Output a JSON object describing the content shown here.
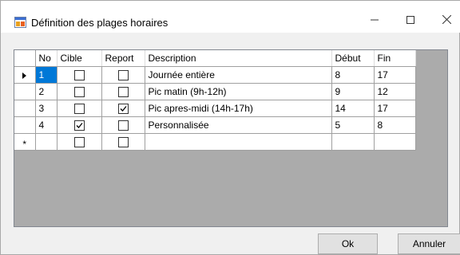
{
  "window": {
    "title": "Définition des plages horaires"
  },
  "grid": {
    "columns": [
      "No",
      "Cible",
      "Report",
      "Description",
      "Début",
      "Fin"
    ],
    "rows": [
      {
        "no": "1",
        "cible": false,
        "report": false,
        "description": "Journée entière",
        "debut": "8",
        "fin": "17",
        "current": true
      },
      {
        "no": "2",
        "cible": false,
        "report": false,
        "description": "Pic matin (9h-12h)",
        "debut": "9",
        "fin": "12",
        "current": false
      },
      {
        "no": "3",
        "cible": false,
        "report": true,
        "description": "Pic apres-midi (14h-17h)",
        "debut": "14",
        "fin": "17",
        "current": false
      },
      {
        "no": "4",
        "cible": true,
        "report": false,
        "description": "Personnalisée",
        "debut": "5",
        "fin": "8",
        "current": false
      }
    ],
    "new_row_marker": "*",
    "colors": {
      "selection": "#0078d7",
      "background": "#ababab"
    }
  },
  "buttons": {
    "ok": "Ok",
    "cancel": "Annuler"
  },
  "icons": {
    "app": "dialog-app-icon",
    "minimize": "minimize-icon",
    "maximize": "maximize-icon",
    "close": "close-icon"
  }
}
